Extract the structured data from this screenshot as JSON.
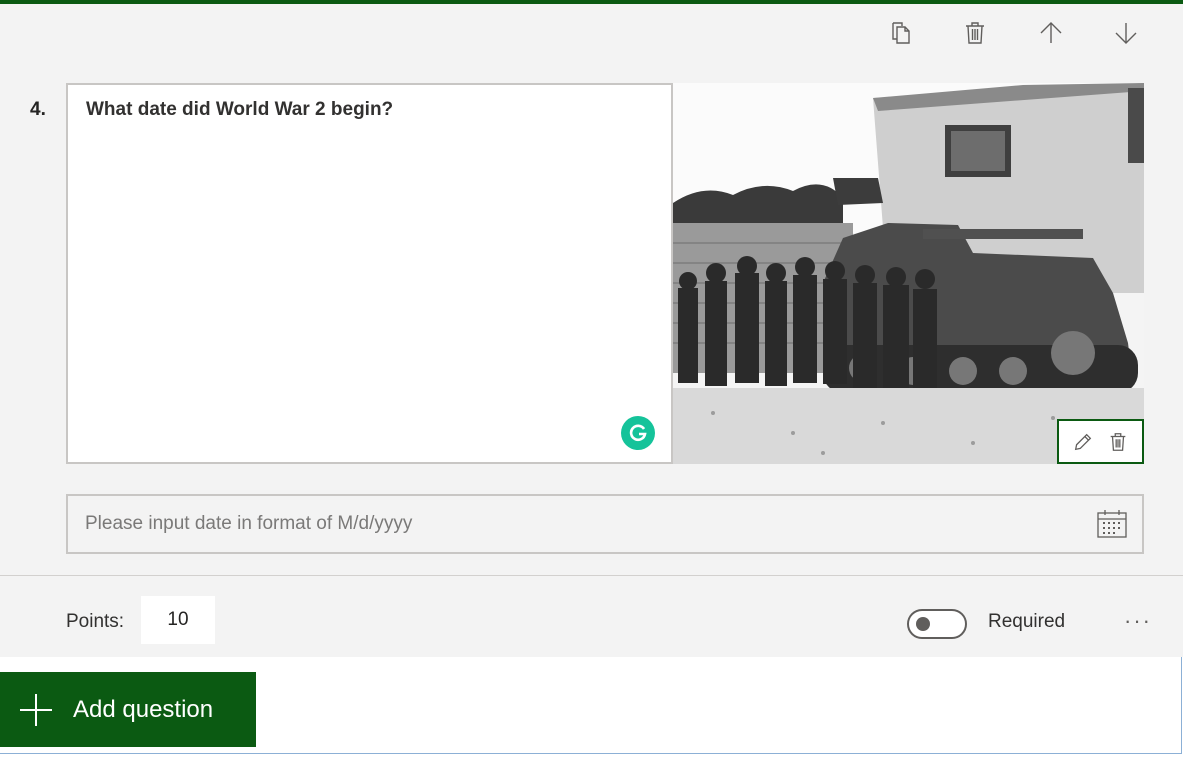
{
  "question": {
    "number": "4.",
    "text": "What date did World War 2 begin?",
    "image_description": "",
    "date_placeholder": "Please input date in format of M/d/yyyy"
  },
  "toolbar": {
    "icons": [
      "copy-icon",
      "trash-icon",
      "arrow-up-icon",
      "arrow-down-icon"
    ]
  },
  "footer": {
    "points_label": "Points:",
    "points_value": "10",
    "required_label": "Required",
    "required_on": false,
    "more_label": "···"
  },
  "add_question": {
    "label": "Add question"
  },
  "colors": {
    "accent": "#0b5a12",
    "card_bg": "#f3f3f3",
    "grammarly": "#15c39a"
  }
}
